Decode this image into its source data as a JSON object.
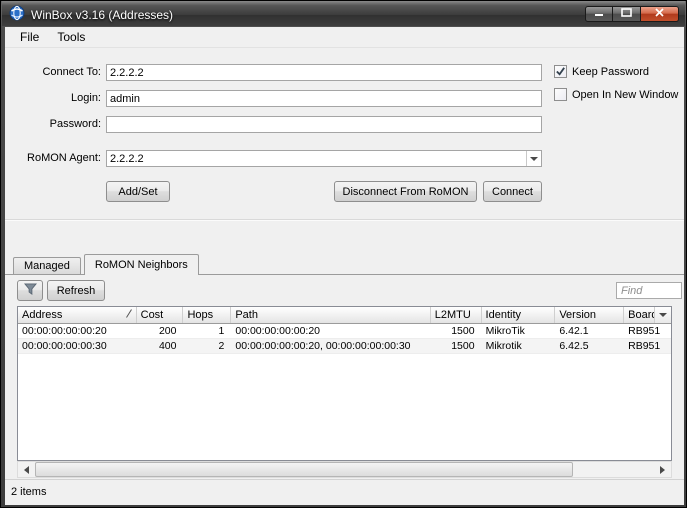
{
  "titlebar": {
    "title": "WinBox v3.16 (Addresses)"
  },
  "menu": {
    "file": "File",
    "tools": "Tools"
  },
  "form": {
    "connect_to_label": "Connect To:",
    "connect_to_value": "2.2.2.2",
    "login_label": "Login:",
    "login_value": "admin",
    "password_label": "Password:",
    "password_value": "",
    "romon_agent_label": "RoMON Agent:",
    "romon_agent_value": "2.2.2.2",
    "keep_password_label": "Keep Password",
    "keep_password_checked": true,
    "open_in_new_window_label": "Open In New Window",
    "open_in_new_window_checked": false,
    "add_set_button": "Add/Set",
    "disconnect_button": "Disconnect From RoMON",
    "connect_button": "Connect"
  },
  "tabs": {
    "managed": "Managed",
    "romon_neighbors": "RoMON Neighbors"
  },
  "toolbar": {
    "refresh": "Refresh",
    "find_placeholder": "Find"
  },
  "table": {
    "columns": {
      "address": "Address",
      "cost": "Cost",
      "hops": "Hops",
      "path": "Path",
      "l2mtu": "L2MTU",
      "identity": "Identity",
      "version": "Version",
      "board": "Board"
    },
    "rows": [
      {
        "address": "00:00:00:00:00:20",
        "cost": "200",
        "hops": "1",
        "path": "00:00:00:00:00:20",
        "l2mtu": "1500",
        "identity": "MikroTik",
        "version": "6.42.1",
        "board": "RB951"
      },
      {
        "address": "00:00:00:00:00:30",
        "cost": "400",
        "hops": "2",
        "path": "00:00:00:00:00:20, 00:00:00:00:00:30",
        "l2mtu": "1500",
        "identity": "Mikrotik",
        "version": "6.42.5",
        "board": "RB951"
      }
    ]
  },
  "statusbar": {
    "items_count": "2 items"
  }
}
